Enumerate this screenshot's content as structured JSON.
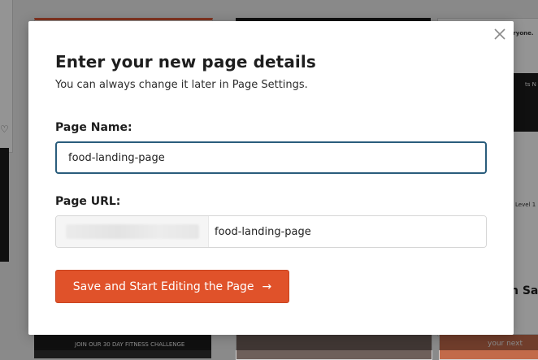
{
  "modal": {
    "title": "Enter your new page details",
    "subtitle": "You can always change it later in Page Settings.",
    "page_name_label": "Page Name:",
    "page_name_value": "food-landing-page",
    "page_url_label": "Page URL:",
    "page_url_slug": "food-landing-page",
    "save_button_label": "Save and Start Editing the Page",
    "save_button_arrow": "→"
  },
  "background": {
    "texts": [
      "veryone.",
      "ts N",
      "Level 1",
      "n Sale",
      "JOIN OUR 30 DAY FITNESS CHALLENGE",
      "your next"
    ]
  },
  "colors": {
    "accent_button": "#e0522a",
    "input_focus_border": "#2a5d7c",
    "overlay": "rgba(0,0,0,0.42)"
  },
  "icons": {
    "close": "close-icon",
    "heart": "heart-icon",
    "arrow": "arrow-right-icon"
  }
}
